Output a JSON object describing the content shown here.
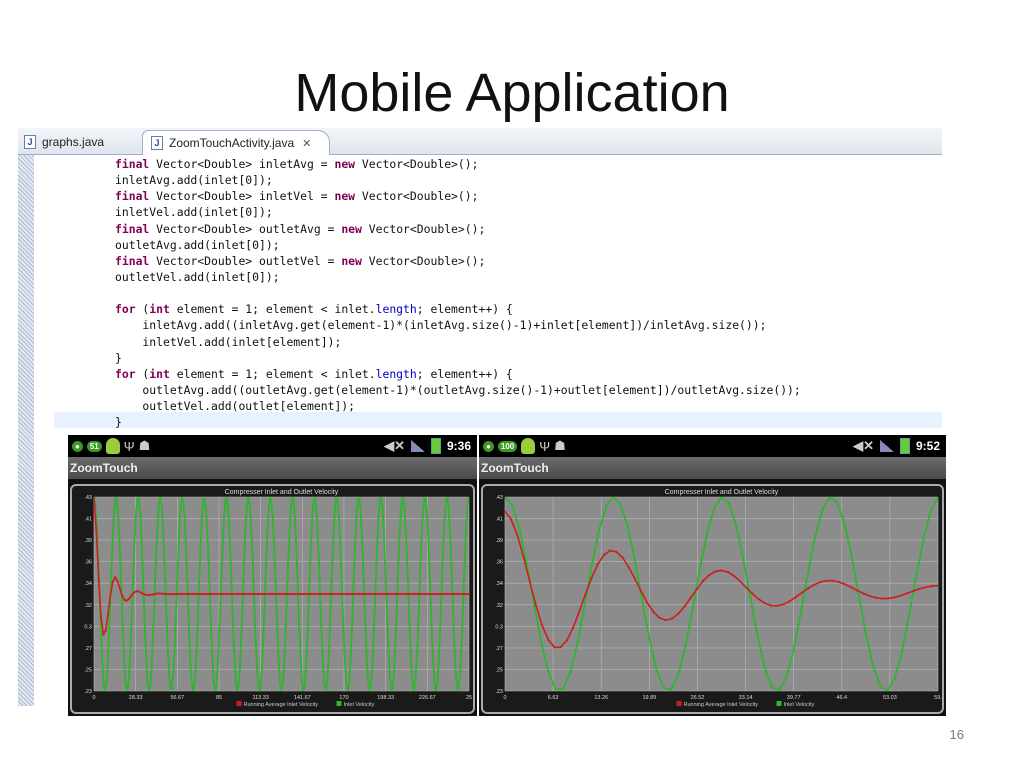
{
  "slide": {
    "title": "Mobile Application",
    "page_number": "16"
  },
  "editor": {
    "tabs": [
      {
        "label": "graphs.java",
        "active": false
      },
      {
        "label": "ZoomTouchActivity.java",
        "active": true
      }
    ],
    "close_glyph": "✕",
    "code_lines": [
      [
        [
          "final",
          "kw"
        ],
        [
          " Vector<Double> inletAvg = ",
          ""
        ],
        [
          "new",
          "kw"
        ],
        [
          " Vector<Double>();",
          ""
        ]
      ],
      [
        [
          "inletAvg.add(inlet[0]);",
          ""
        ]
      ],
      [
        [
          "final",
          "kw"
        ],
        [
          " Vector<Double> inletVel = ",
          ""
        ],
        [
          "new",
          "kw"
        ],
        [
          " Vector<Double>();",
          ""
        ]
      ],
      [
        [
          "inletVel.add(inlet[0]);",
          ""
        ]
      ],
      [
        [
          "final",
          "kw"
        ],
        [
          " Vector<Double> outletAvg = ",
          ""
        ],
        [
          "new",
          "kw"
        ],
        [
          " Vector<Double>();",
          ""
        ]
      ],
      [
        [
          "outletAvg.add(inlet[0]);",
          ""
        ]
      ],
      [
        [
          "final",
          "kw"
        ],
        [
          " Vector<Double> outletVel = ",
          ""
        ],
        [
          "new",
          "kw"
        ],
        [
          " Vector<Double>();",
          ""
        ]
      ],
      [
        [
          "outletVel.add(inlet[0]);",
          ""
        ]
      ],
      [
        [
          "",
          ""
        ]
      ],
      [
        [
          "for",
          "kw"
        ],
        [
          " (",
          ""
        ],
        [
          "int",
          "kw"
        ],
        [
          " element = 1; element < inlet.",
          ""
        ],
        [
          "length",
          "fld"
        ],
        [
          "; element++) {",
          ""
        ]
      ],
      [
        [
          "    inletAvg.add((inletAvg.get(element-1)*(inletAvg.size()-1)+inlet[element])/inletAvg.size());",
          ""
        ]
      ],
      [
        [
          "    inletVel.add(inlet[element]);",
          ""
        ]
      ],
      [
        [
          "}",
          ""
        ]
      ],
      [
        [
          "for",
          "kw"
        ],
        [
          " (",
          ""
        ],
        [
          "int",
          "kw"
        ],
        [
          " element = 1; element < inlet.",
          ""
        ],
        [
          "length",
          "fld"
        ],
        [
          "; element++) {",
          ""
        ]
      ],
      [
        [
          "    outletAvg.add((outletAvg.get(element-1)*(outletAvg.size()-1)+outlet[element])/outletAvg.size());",
          ""
        ]
      ],
      [
        [
          "    outletVel.add(outlet[element]);",
          ""
        ]
      ],
      [
        [
          "}",
          ""
        ]
      ]
    ]
  },
  "phones": [
    {
      "battery": "51",
      "time": "9:36",
      "app_title": "ZoomTouch",
      "icons": [
        "notification-icon",
        "android-icon",
        "usb-icon",
        "debug-icon",
        "mute-icon",
        "signal-icon",
        "battery-icon"
      ]
    },
    {
      "battery": "100",
      "time": "9:52",
      "app_title": "ZoomTouch",
      "icons": [
        "notification-icon",
        "android-icon",
        "usb-icon",
        "debug-icon",
        "mute-icon",
        "signal-icon",
        "battery-icon"
      ]
    }
  ],
  "colors": {
    "inlet": "#2fb52f",
    "average": "#cc1f1f",
    "plot_bg": "#8c8c8c",
    "grid": "#b8b8b8"
  },
  "chart_data": [
    {
      "type": "line",
      "title": "Compresser Inlet and Outlet Velocity",
      "x_ticks": [
        "0",
        "28.33",
        "56.67",
        "85",
        "113.33",
        "141.67",
        "170",
        "198.33",
        "226.67",
        "25"
      ],
      "y_ticks": [
        ".23",
        ".25",
        ".27",
        "0.3",
        ".32",
        ".34",
        ".36",
        ".39",
        ".41",
        ".43"
      ],
      "xlim": [
        0,
        255
      ],
      "ylim": [
        0.23,
        0.43
      ],
      "series": [
        {
          "name": "Running Average Inlet Velocity",
          "kind": "damped",
          "start": 0.43,
          "mean": 0.33,
          "amp": 0.1,
          "decay": 0.12,
          "period": 15,
          "points": 160
        },
        {
          "name": "Inlet Velocity",
          "kind": "wave",
          "mean": 0.33,
          "amp": 0.1,
          "period": 15,
          "points": 260
        }
      ],
      "legend": "bottom"
    },
    {
      "type": "line",
      "title": "Compresser Inlet and Outlet Velocity",
      "x_ticks": [
        "0",
        "6.63",
        "13.26",
        "19.89",
        "26.52",
        "33.14",
        "39.77",
        "46.4",
        "53.03",
        "59."
      ],
      "y_ticks": [
        ".23",
        ".25",
        ".27",
        "0.3",
        ".32",
        ".34",
        ".36",
        ".39",
        ".41",
        ".43"
      ],
      "xlim": [
        0,
        59.7
      ],
      "ylim": [
        0.23,
        0.43
      ],
      "series": [
        {
          "name": "Running Average Inlet Velocity",
          "kind": "damped",
          "start": 0.415,
          "mean": 0.333,
          "amp": 0.09,
          "decay": 0.045,
          "period": 15,
          "points": 70
        },
        {
          "name": "Inlet Velocity",
          "kind": "wave",
          "mean": 0.33,
          "amp": 0.1,
          "period": 15,
          "points": 60
        }
      ],
      "legend": "bottom"
    }
  ]
}
